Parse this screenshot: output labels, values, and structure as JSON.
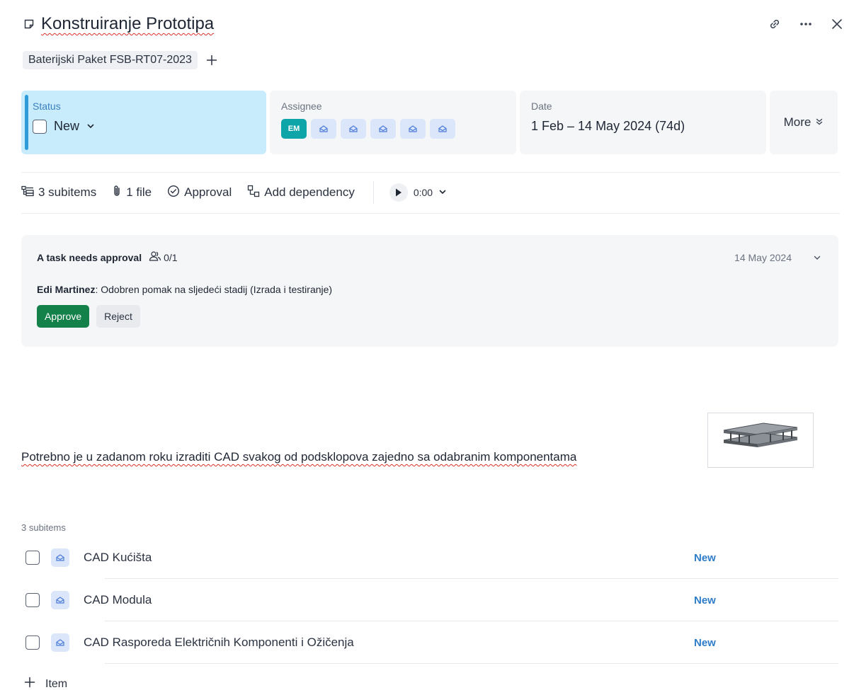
{
  "header": {
    "title": "Konstruiranje Prototipa",
    "title_icon": "note-icon",
    "actions": [
      "link-icon",
      "more-icon",
      "close-icon"
    ]
  },
  "tags": {
    "project": "Baterijski Paket FSB-RT07-2023",
    "add_icon": "plus-icon"
  },
  "fields": {
    "status": {
      "label": "Status",
      "value": "New"
    },
    "assignee": {
      "label": "Assignee",
      "initials": "EM",
      "placeholders": 5
    },
    "date": {
      "label": "Date",
      "value": "1 Feb – 14 May 2024 (74d)"
    },
    "more": {
      "label": "More"
    }
  },
  "toolbar": {
    "subitems": "3 subitems",
    "files": "1 file",
    "approval": "Approval",
    "dependency": "Add dependency",
    "timer": "0:00"
  },
  "approval": {
    "title": "A task needs approval",
    "count": "0/1",
    "date": "14 May 2024",
    "author": "Edi Martinez",
    "message": ": Odobren pomak na sljedeći stadij (Izrada i testiranje)",
    "approve_label": "Approve",
    "reject_label": "Reject"
  },
  "description": {
    "text": "Potrebno je u zadanom roku izraditi CAD svakog od podsklopova zajedno sa odabranim komponentama"
  },
  "subitems": {
    "heading": "3 subitems",
    "items": [
      {
        "name": "CAD Kućišta",
        "status": "New"
      },
      {
        "name": "CAD Modula",
        "status": "New"
      },
      {
        "name": "CAD Rasporeda Električnih Komponenti i Ožičenja",
        "status": "New"
      }
    ],
    "add_label": "Item"
  },
  "colors": {
    "status_bg": "#c8ecfb",
    "approve": "#14804a",
    "status_text": "#2e7dc9",
    "avatar_em": "#0ea5a8"
  }
}
